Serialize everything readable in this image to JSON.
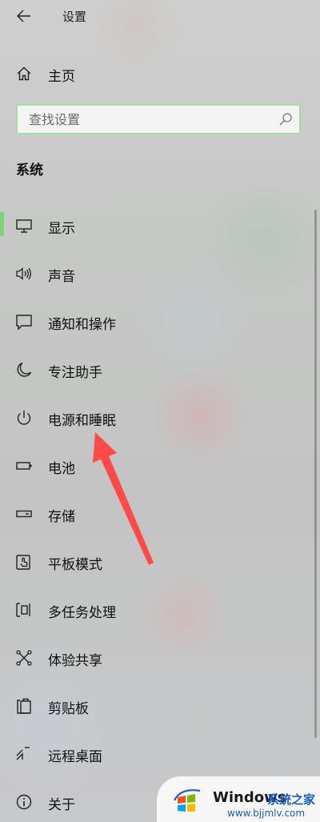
{
  "header": {
    "title": "设置"
  },
  "home": {
    "label": "主页"
  },
  "search": {
    "placeholder": "查找设置",
    "value": ""
  },
  "section": {
    "title": "系统"
  },
  "nav": {
    "selected_index": 0,
    "items": [
      {
        "label": "显示",
        "icon": "display-icon"
      },
      {
        "label": "声音",
        "icon": "speaker-icon"
      },
      {
        "label": "通知和操作",
        "icon": "notification-icon"
      },
      {
        "label": "专注助手",
        "icon": "moon-icon"
      },
      {
        "label": "电源和睡眠",
        "icon": "power-icon"
      },
      {
        "label": "电池",
        "icon": "battery-icon"
      },
      {
        "label": "存储",
        "icon": "storage-icon"
      },
      {
        "label": "平板模式",
        "icon": "tablet-mode-icon"
      },
      {
        "label": "多任务处理",
        "icon": "multitasking-icon"
      },
      {
        "label": "体验共享",
        "icon": "shared-experiences-icon"
      },
      {
        "label": "剪贴板",
        "icon": "clipboard-icon"
      },
      {
        "label": "远程桌面",
        "icon": "remote-desktop-icon"
      },
      {
        "label": "关于",
        "icon": "info-icon"
      }
    ]
  },
  "watermark": {
    "brand": "Windows",
    "site": "系统之家",
    "url": "www.bjjmlv.com"
  },
  "colors": {
    "accent": "#7fd177",
    "annotation": "#ff4a4a",
    "link": "#1a5cc6"
  }
}
